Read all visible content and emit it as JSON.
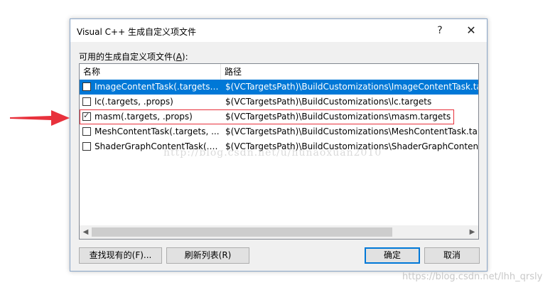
{
  "dialog": {
    "title": "Visual C++ 生成自定义项文件",
    "help_glyph": "?",
    "close_glyph": "✕",
    "list_caption_prefix": "可用的生成自定义项文件(",
    "list_caption_key": "A",
    "list_caption_suffix": "):",
    "columns": {
      "name": "名称",
      "path": "路径"
    },
    "rows": [
      {
        "checked": false,
        "name": "ImageContentTask(.targets, ...",
        "path": "$(VCTargetsPath)\\BuildCustomizations\\ImageContentTask.tar",
        "selected": true
      },
      {
        "checked": false,
        "name": "lc(.targets, .props)",
        "path": "$(VCTargetsPath)\\BuildCustomizations\\lc.targets",
        "selected": false
      },
      {
        "checked": true,
        "name": "masm(.targets, .props)",
        "path": "$(VCTargetsPath)\\BuildCustomizations\\masm.targets",
        "selected": false
      },
      {
        "checked": false,
        "name": "MeshContentTask(.targets, ...",
        "path": "$(VCTargetsPath)\\BuildCustomizations\\MeshContentTask.targ",
        "selected": false
      },
      {
        "checked": false,
        "name": "ShaderGraphContentTask(.ta...",
        "path": "$(VCTargetsPath)\\BuildCustomizations\\ShaderGraphContentT",
        "selected": false
      }
    ],
    "buttons": {
      "find_existing": "查找现有的(F)...",
      "refresh": "刷新列表(R)",
      "ok": "确定",
      "cancel": "取消"
    }
  },
  "overlay": {
    "watermark": "http://blog.csdn.net/u/hunaoxuan2010",
    "credit": "https://blog.csdn.net/lhh_qrsly",
    "arrow_color": "#e8313c",
    "highlight_color": "#e8313c"
  },
  "colors": {
    "selection": "#0078d7",
    "default_button_border": "#0078d7"
  }
}
